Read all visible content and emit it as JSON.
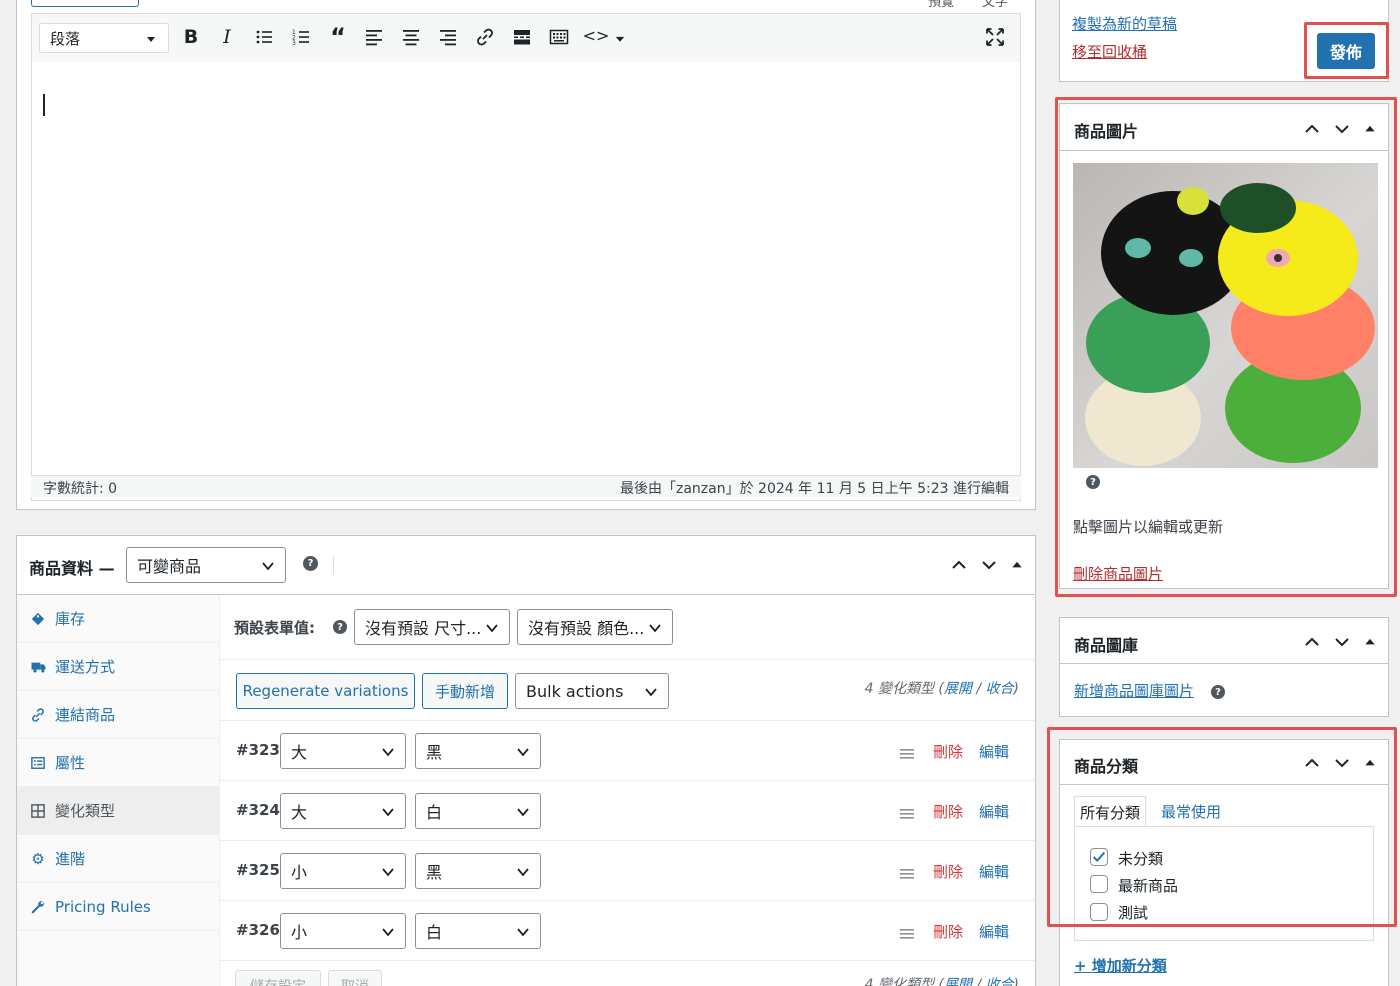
{
  "editor": {
    "toolbar_top_btn1": "預覽",
    "toolbar_top_btn2": "文字",
    "format_select": "段落",
    "word_count": "字數統計: 0",
    "last_edited": "最後由「zanzan」於 2024 年 11 月 5 日上午 5:23 進行編輯"
  },
  "publish": {
    "copy_draft": "複製為新的草稿",
    "move_trash": "移至回收桶",
    "publish_button": "發佈"
  },
  "product_image": {
    "title": "商品圖片",
    "hint": "點擊圖片以編輯或更新",
    "remove_link": "刪除商品圖片"
  },
  "gallery": {
    "title": "商品圖庫",
    "add_link": "新增商品圖庫圖片"
  },
  "categories": {
    "title": "商品分類",
    "tab_all": "所有分類",
    "tab_popular": "最常使用",
    "items": [
      {
        "label": "未分類",
        "checked": true
      },
      {
        "label": "最新商品",
        "checked": false
      },
      {
        "label": "測試",
        "checked": false
      }
    ],
    "add_link": "+ 增加新分類"
  },
  "product_data": {
    "title": "商品資料 —",
    "type_select": "可變商品",
    "tabs": [
      {
        "label": "庫存",
        "icon": "tag-icon"
      },
      {
        "label": "運送方式",
        "icon": "truck-icon"
      },
      {
        "label": "連結商品",
        "icon": "link-icon"
      },
      {
        "label": "屬性",
        "icon": "list-icon"
      },
      {
        "label": "變化類型",
        "icon": "grid-icon"
      },
      {
        "label": "進階",
        "icon": "gear-icon"
      },
      {
        "label": "Pricing Rules",
        "icon": "wrench-icon"
      }
    ],
    "defaults_label": "預設表單值:",
    "default_size": "沒有預設 尺寸...",
    "default_color": "沒有預設 顏色...",
    "regen_button": "Regenerate variations",
    "manual_add_button": "手動新增",
    "bulk_actions": "Bulk actions",
    "variation_count_prefix": "4 變化類型 (",
    "expand": "展開",
    "sep": " / ",
    "collapse": "收合",
    "close_paren": ")",
    "variations": [
      {
        "id": "#323",
        "size": "大",
        "color": "黑"
      },
      {
        "id": "#324",
        "size": "大",
        "color": "白"
      },
      {
        "id": "#325",
        "size": "小",
        "color": "黑"
      },
      {
        "id": "#326",
        "size": "小",
        "color": "白"
      }
    ],
    "delete_label": "刪除",
    "edit_label": "編輯",
    "save_button": "儲存設定",
    "cancel_button": "取消"
  },
  "colors": {
    "accent": "#2271b1",
    "highlight": "#e0524d",
    "delete": "#d63638"
  }
}
